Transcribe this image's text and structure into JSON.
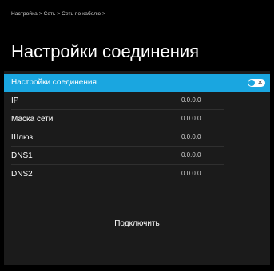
{
  "breadcrumb": "Настройка > Сеть > Сеть по кабелю >",
  "title": "Настройки соединения",
  "toggle": {
    "label": "Настройки соединения",
    "on": true
  },
  "fields": [
    {
      "label": "IP",
      "value": "0.0.0.0"
    },
    {
      "label": "Маска сети",
      "value": "0.0.0.0"
    },
    {
      "label": "Шлюз",
      "value": "0.0.0.0"
    },
    {
      "label": "DNS1",
      "value": "0.0.0.0"
    },
    {
      "label": "DNS2",
      "value": "0.0.0.0"
    }
  ],
  "connect_label": "Подключить",
  "colors": {
    "accent": "#1aa6e0",
    "background": "#1b1b1b",
    "header": "#000000"
  }
}
